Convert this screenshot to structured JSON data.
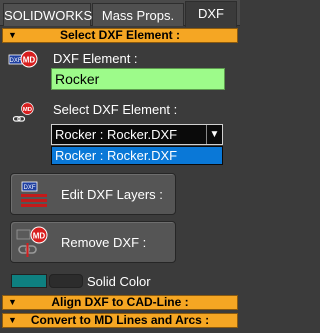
{
  "tabs": [
    {
      "label": "SOLIDWORKS"
    },
    {
      "label": "Mass Props."
    },
    {
      "label": "DXF"
    }
  ],
  "sections": {
    "select_dxf_element": "Select DXF Element :",
    "align_dxf": "Align DXF to CAD-Line :",
    "convert_md": "Convert to MD Lines and Arcs :"
  },
  "dxf_element": {
    "label": "DXF Element :",
    "value": "Rocker"
  },
  "select_dxf": {
    "label": "Select DXF Element :",
    "selected": "Rocker : Rocker.DXF",
    "options": [
      "Rocker : Rocker.DXF"
    ]
  },
  "buttons": {
    "edit_layers": "Edit DXF Layers :",
    "remove_dxf": "Remove DXF :"
  },
  "solid_color": {
    "label": "Solid Color",
    "swatch_color": "#0e8080"
  },
  "icon_text": {
    "dxf": "DXF",
    "md": "MD"
  },
  "colors": {
    "accent_orange": "#f5a623",
    "field_green": "#9dfb8a",
    "selection_blue": "#0a78d7"
  }
}
